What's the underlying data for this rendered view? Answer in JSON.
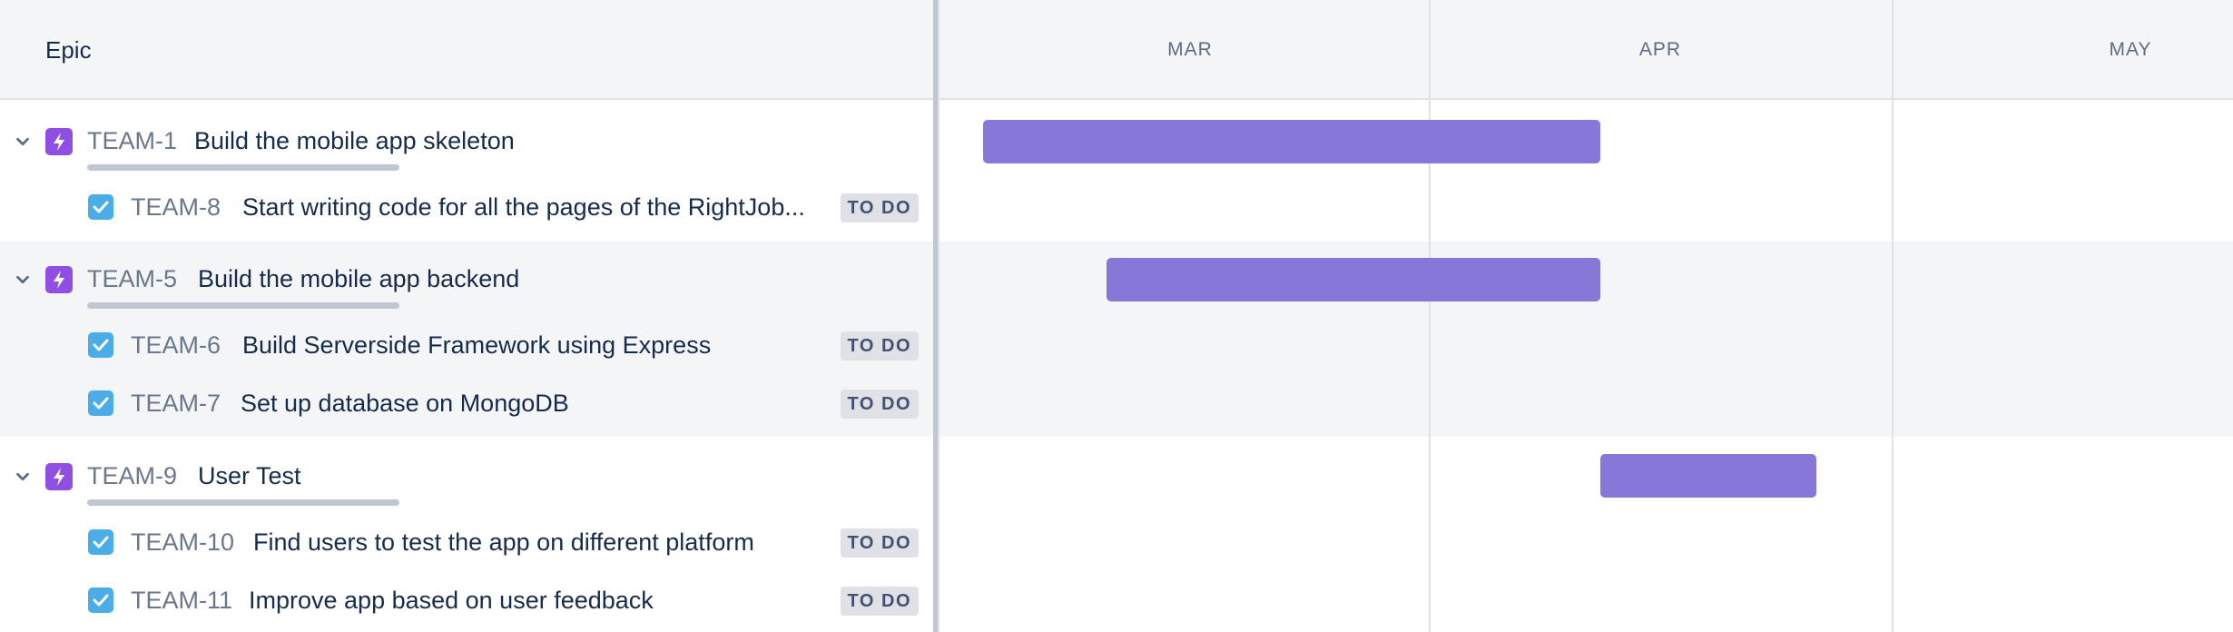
{
  "header": {
    "title": "Epic"
  },
  "timeline": {
    "months": [
      "MAR",
      "APR",
      "MAY"
    ]
  },
  "colors": {
    "epic_bar": "#8777d9",
    "epic_icon": "#904ee2",
    "task_icon": "#4bade8",
    "status_bg": "#dfe1e6"
  },
  "epics": [
    {
      "key": "TEAM-1",
      "title": "Build the mobile app skeleton",
      "icon": "epic-lightning-icon",
      "children": [
        {
          "key": "TEAM-8",
          "title": "Start writing code for all the pages of the RightJob...",
          "status": "TO DO",
          "icon": "checkbox-icon"
        }
      ]
    },
    {
      "key": "TEAM-5",
      "title": "Build the mobile app backend",
      "icon": "epic-lightning-icon",
      "children": [
        {
          "key": "TEAM-6",
          "title": "Build Serverside Framework using Express",
          "status": "TO DO",
          "icon": "checkbox-icon"
        },
        {
          "key": "TEAM-7",
          "title": "Set up database on MongoDB",
          "status": "TO DO",
          "icon": "checkbox-icon"
        }
      ]
    },
    {
      "key": "TEAM-9",
      "title": "User Test",
      "icon": "epic-lightning-icon",
      "children": [
        {
          "key": "TEAM-10",
          "title": "Find users to test the app on different platform",
          "status": "TO DO",
          "icon": "checkbox-icon"
        },
        {
          "key": "TEAM-11",
          "title": "Improve app based on user feedback",
          "status": "TO DO",
          "icon": "checkbox-icon"
        }
      ]
    }
  ]
}
